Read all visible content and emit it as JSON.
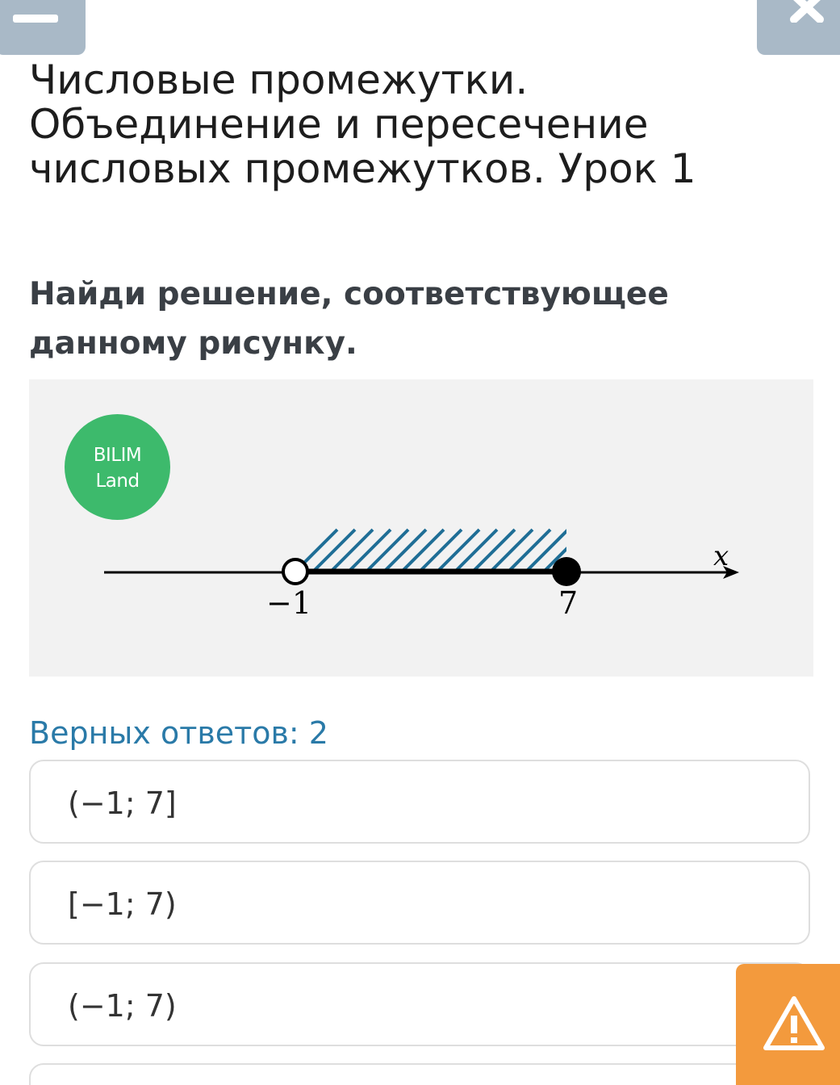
{
  "header": {
    "title": "Числовые промежутки. Объединение и пересечение числовых промежутков. Урок 1"
  },
  "question": {
    "text": "Найди решение, соответствующее данному рисунку."
  },
  "figure": {
    "logo_line1": "BILIM",
    "logo_line2": "Land",
    "axis_label": "x",
    "left_point_label": "−1",
    "right_point_label": "7",
    "left_point": -1,
    "right_point": 7,
    "left_point_style": "open",
    "right_point_style": "closed",
    "shaded_between": true,
    "colors": {
      "hatch": "#1f6e96",
      "logo_bg": "#3dba6c",
      "figure_bg": "#f2f2f2"
    }
  },
  "answers": {
    "count_label": "Верных ответов: 2",
    "options": [
      {
        "label": "(−1; 7]"
      },
      {
        "label": "[−1; 7)"
      },
      {
        "label": "(−1; 7)"
      }
    ]
  },
  "icons": {
    "top_left": "minimize-icon",
    "top_right": "close-icon",
    "report": "warning-icon"
  },
  "colors": {
    "top_buttons": "#a9b9c7",
    "report_button": "#f39a3d",
    "answers_count": "#2a7aa8"
  }
}
